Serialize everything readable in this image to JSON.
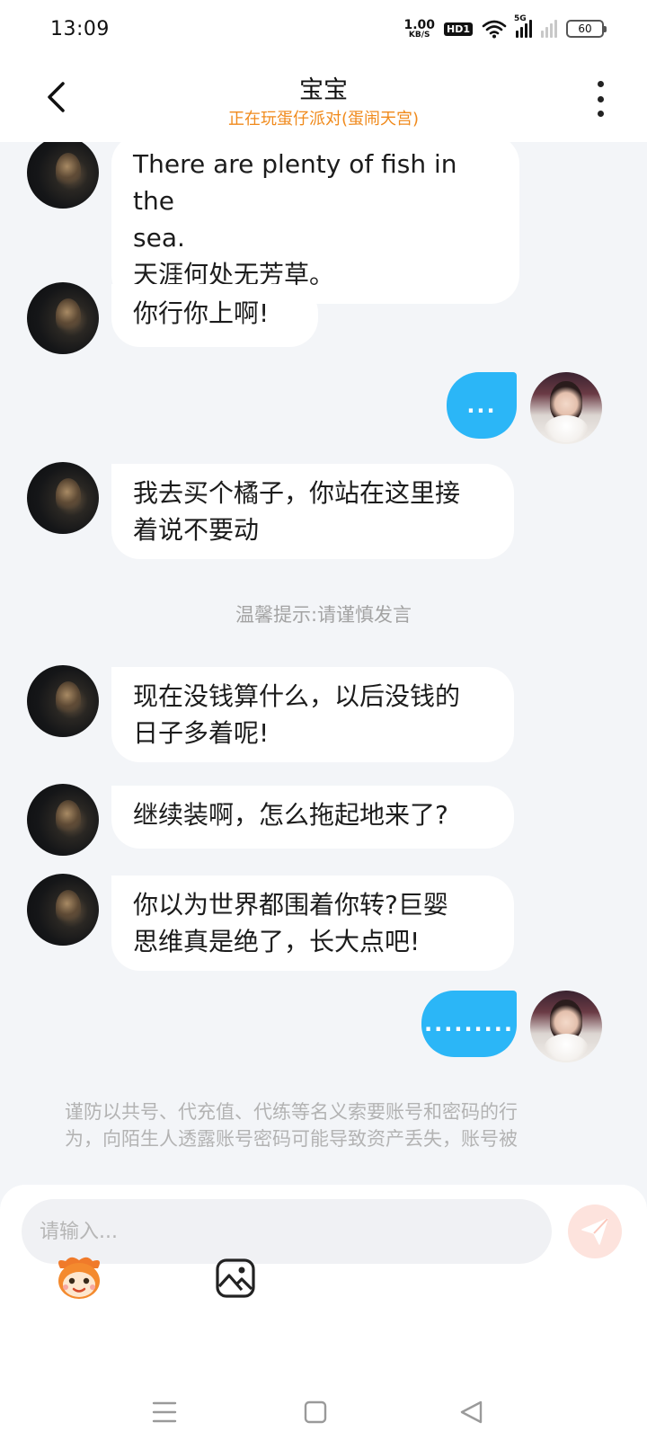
{
  "status_bar": {
    "time": "13:09",
    "net_speed_value": "1.00",
    "net_speed_unit": "KB/S",
    "hd_label": "HD1",
    "network_label": "5G",
    "battery_level": "60"
  },
  "header": {
    "title": "宝宝",
    "subtitle": "正在玩蛋仔派对(蛋闹天宫)"
  },
  "messages": [
    {
      "direction": "in",
      "lines": [
        "There are plenty of fish in the",
        "sea.",
        "天涯何处无芳草。"
      ]
    },
    {
      "direction": "in",
      "lines": [
        "你行你上啊!"
      ]
    },
    {
      "direction": "out",
      "text": "..."
    },
    {
      "direction": "in",
      "lines": [
        "我去买个橘子，你站在这里接",
        "着说不要动"
      ]
    },
    {
      "direction": "system",
      "text": "温馨提示:请谨慎发言"
    },
    {
      "direction": "in",
      "lines": [
        "现在没钱算什么，以后没钱的",
        "日子多着呢!"
      ]
    },
    {
      "direction": "in",
      "lines": [
        "继续装啊，怎么拖起地来了?"
      ]
    },
    {
      "direction": "in",
      "lines": [
        "你以为世界都围着你转?巨婴",
        "思维真是绝了，长大点吧!"
      ]
    },
    {
      "direction": "out",
      "text": "........."
    }
  ],
  "disclaimer": {
    "line1": "谨防以共号、代充值、代练等名义索要账号和密码的行",
    "line2": "为，向陌生人透露账号密码可能导致资产丢失，账号被"
  },
  "composer": {
    "placeholder": "请输入..."
  },
  "colors": {
    "accent_blue": "#2bb6f7",
    "subtitle_orange": "#f08a1c",
    "send_disabled": "#fde3dd"
  },
  "icons": {
    "back": "chevron-left-icon",
    "more": "more-vertical-icon",
    "send": "send-icon",
    "emoji": "eggy-emoji-icon",
    "image": "image-icon",
    "nav_menu": "menu-icon",
    "nav_home": "home-square-icon",
    "nav_back": "back-triangle-icon"
  }
}
